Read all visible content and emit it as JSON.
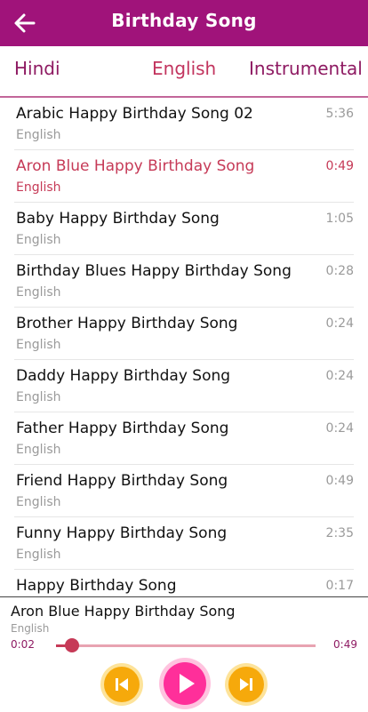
{
  "header": {
    "title": "Birthday Song",
    "back_icon": "back-arrow-icon",
    "bg_color": "#a0137a"
  },
  "tabs": [
    {
      "label": "Hindi"
    },
    {
      "label": "English",
      "active": true
    },
    {
      "label": "Instrumental"
    }
  ],
  "songs": [
    {
      "title": "Arabic Happy Birthday Song 02",
      "subtitle": "English",
      "duration": "5:36"
    },
    {
      "title": "Aron Blue Happy Birthday Song",
      "subtitle": "English",
      "duration": "0:49",
      "active": true
    },
    {
      "title": "Baby Happy Birthday Song",
      "subtitle": "English",
      "duration": "1:05"
    },
    {
      "title": "Birthday Blues Happy Birthday Song",
      "subtitle": "English",
      "duration": "0:28"
    },
    {
      "title": "Brother Happy Birthday Song",
      "subtitle": "English",
      "duration": "0:24"
    },
    {
      "title": "Daddy Happy Birthday Song",
      "subtitle": "English",
      "duration": "0:24"
    },
    {
      "title": "Father Happy Birthday Song",
      "subtitle": "English",
      "duration": "0:24"
    },
    {
      "title": "Friend Happy Birthday Song",
      "subtitle": "English",
      "duration": "0:49"
    },
    {
      "title": "Funny Happy Birthday Song",
      "subtitle": "English",
      "duration": "2:35"
    },
    {
      "title": "Happy Birthday Song",
      "subtitle": "",
      "duration": "0:17"
    }
  ],
  "player": {
    "title": "Aron Blue Happy Birthday Song",
    "subtitle": "English",
    "elapsed": "0:02",
    "total": "0:49",
    "progress_fraction": 0.06,
    "prev_icon": "previous-icon",
    "play_icon": "play-icon",
    "next_icon": "next-icon"
  },
  "colors": {
    "accent": "#c63a57",
    "tab_text": "#8e1a62",
    "play_button": "#ff2f9a",
    "skip_button": "#f6a90b"
  }
}
